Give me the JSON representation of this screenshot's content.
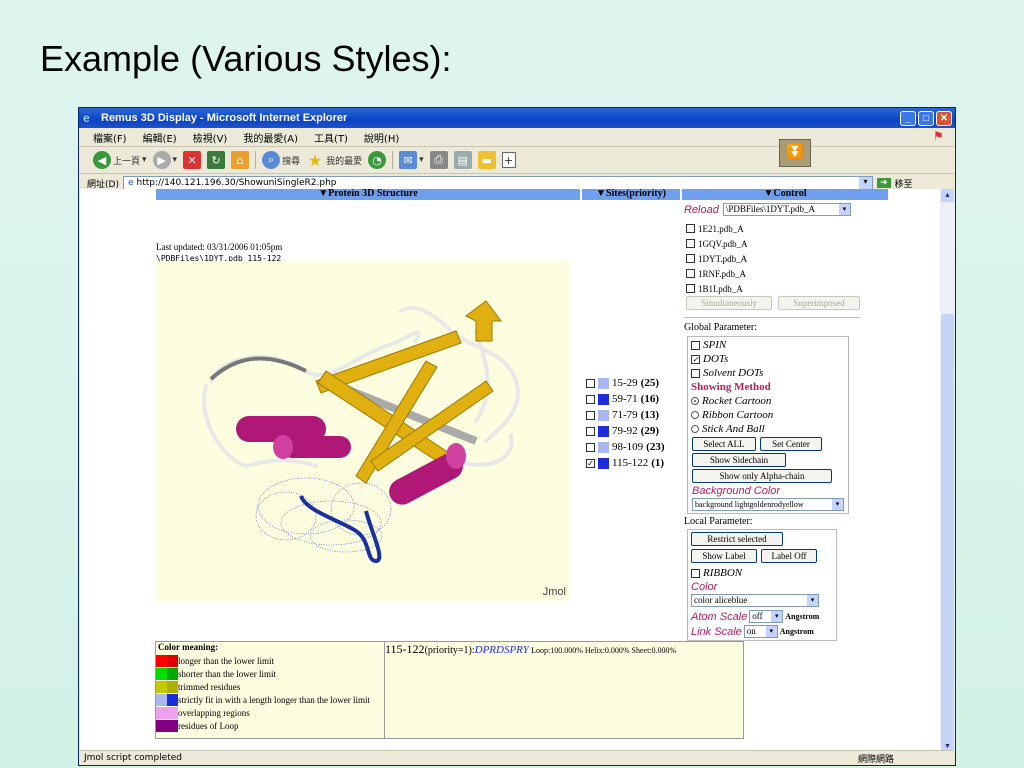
{
  "slide": {
    "title": "Example (Various Styles):"
  },
  "window": {
    "title": "Remus 3D Display - Microsoft Internet Explorer",
    "controls": {
      "minimize": "_",
      "maximize": "□",
      "close": "✕"
    }
  },
  "menu": [
    "檔案(F)",
    "編輯(E)",
    "檢視(V)",
    "我的最愛(A)",
    "工具(T)",
    "說明(H)"
  ],
  "toolbar": {
    "back": "上一頁",
    "search": "搜尋",
    "favorites": "我的最愛"
  },
  "address": {
    "label": "網址(D)",
    "url": "http://140.121.196.30/ShowuniSingleR2.php",
    "go": "移至"
  },
  "status": {
    "left": "Jmol script completed",
    "zone": "網際網路"
  },
  "headers": {
    "structure": "▼Protein 3D Structure",
    "sites": "▼Sites(priority)",
    "control": "▼Control"
  },
  "structure": {
    "last_updated": "Last updated: 03/31/2006 01:05pm",
    "file": "\\PDBFiles\\1DYT.pdb 115-122",
    "jmol_label": "Jmol"
  },
  "sites": [
    {
      "range": "15-29",
      "priority": "(25)",
      "color": "#a9b8f0",
      "checked": false
    },
    {
      "range": "59-71",
      "priority": "(16)",
      "color": "#1a2fd8",
      "checked": false
    },
    {
      "range": "71-79",
      "priority": "(13)",
      "color": "#a9b8f0",
      "checked": false
    },
    {
      "range": "79-92",
      "priority": "(29)",
      "color": "#1a2fd8",
      "checked": false
    },
    {
      "range": "98-109",
      "priority": "(23)",
      "color": "#a9b8f0",
      "checked": false
    },
    {
      "range": "115-122",
      "priority": "(1)",
      "color": "#1a2fd8",
      "checked": true
    }
  ],
  "control": {
    "reload_label": "Reload",
    "reload_value": "\\PDBFiles\\1DYT.pdb_A",
    "pdb_files": [
      "1E21.pdb_A",
      "1GQV.pdb_A",
      "1DYT.pdb_A",
      "1RNF.pdb_A",
      "1B1I.pdb_A"
    ],
    "btn_simultaneously": "Simultaneously",
    "btn_superimposed": "Superimposed",
    "global_label": "Global Parameter:",
    "global_opts": [
      {
        "label": "SPIN",
        "checked": false
      },
      {
        "label": "DOTs",
        "checked": true
      },
      {
        "label": "Solvent DOTs",
        "checked": false
      }
    ],
    "showing_method": "Showing Method",
    "methods": [
      {
        "label": "Rocket Cartoon",
        "on": true
      },
      {
        "label": "Ribbon Cartoon",
        "on": false
      },
      {
        "label": "Stick And Ball",
        "on": false
      }
    ],
    "btn_select_all": "Select ALL",
    "btn_set_center": "Set Center",
    "btn_show_sidechain": "Show Sidechain",
    "btn_alpha": "Show only Alpha-chain",
    "bg_label": "Background Color",
    "bg_value": "background lightgoldenrodyellow",
    "local_label": "Local Parameter:",
    "btn_restrict": "Restrict selected",
    "btn_show_label": "Show Label",
    "btn_label_off": "Label Off",
    "ribbon": "RIBBON",
    "color_label": "Color",
    "color_value": "color aliceblue",
    "atom_scale_label": "Atom Scale",
    "atom_scale_value": "off",
    "link_scale_label": "Link Scale",
    "link_scale_value": "on",
    "unit": "Angstrom"
  },
  "legend": {
    "title": "Color meaning:",
    "items": [
      {
        "text": "longer than the lower limit",
        "c1": "#ff0000",
        "c2": "#dd0000"
      },
      {
        "text": "shorter than the lower limit",
        "c1": "#00dd00",
        "c2": "#00aa00"
      },
      {
        "text": "trimmed residues",
        "c1": "#c8c800",
        "c2": "#b0b000"
      },
      {
        "text": "strictly fit in with a length longer than the lower limit",
        "c1": "#aab8f0",
        "c2": "#1a2fd8"
      },
      {
        "text": "overlapping regions",
        "c1": "#f0a0f0",
        "c2": "#f0a0f0"
      },
      {
        "text": "residues of Loop",
        "c1": "#800080",
        "c2": "#800080"
      }
    ]
  },
  "info": {
    "range": "115-122",
    "priority": "(priority=1):",
    "seq": "DPRDSPRY",
    "stats": "Loop:100.000% Helix:0.000% Sheet:0.000%"
  }
}
